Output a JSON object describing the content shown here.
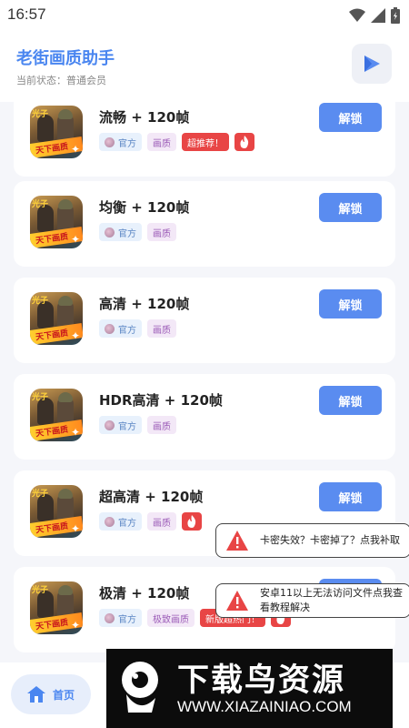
{
  "status_bar": {
    "time": "16:57"
  },
  "header": {
    "title": "老街画质助手",
    "status_line": "当前状态：普通会员"
  },
  "cards": [
    {
      "title": "流畅 + 120帧",
      "tag_official": "官方",
      "tag_quality": "画质",
      "tag_hot": "超推荐！",
      "fire": true,
      "button": "解锁"
    },
    {
      "title": "均衡 + 120帧",
      "tag_official": "官方",
      "tag_quality": "画质",
      "tag_hot": "",
      "fire": false,
      "button": "解锁"
    },
    {
      "title": "高清 + 120帧",
      "tag_official": "官方",
      "tag_quality": "画质",
      "tag_hot": "",
      "fire": false,
      "button": "解锁"
    },
    {
      "title": "HDR高清 + 120帧",
      "tag_official": "官方",
      "tag_quality": "画质",
      "tag_hot": "",
      "fire": false,
      "button": "解锁"
    },
    {
      "title": "超高清 + 120帧",
      "tag_official": "官方",
      "tag_quality": "画质",
      "tag_hot": "",
      "fire": true,
      "button": "解锁"
    },
    {
      "title": "极清 + 120帧",
      "tag_official": "官方",
      "tag_quality": "极致画质",
      "tag_hot": "新版超热门！",
      "fire": true,
      "button": "解锁"
    }
  ],
  "game_icon": {
    "badge": "光子",
    "logo": "天下画质"
  },
  "toasts": [
    {
      "text": "卡密失效？卡密掉了？点我补取"
    },
    {
      "text": "安卓11以上无法访问文件点我查看教程解决"
    }
  ],
  "bottom_nav": {
    "home_label": "首页"
  },
  "watermark": {
    "title": "下载鸟资源",
    "url": "WWW.XIAZAINIAO.COM"
  },
  "colors": {
    "accent": "#5a8cf0",
    "hot": "#e84545",
    "title_blue": "#4a86f0"
  }
}
